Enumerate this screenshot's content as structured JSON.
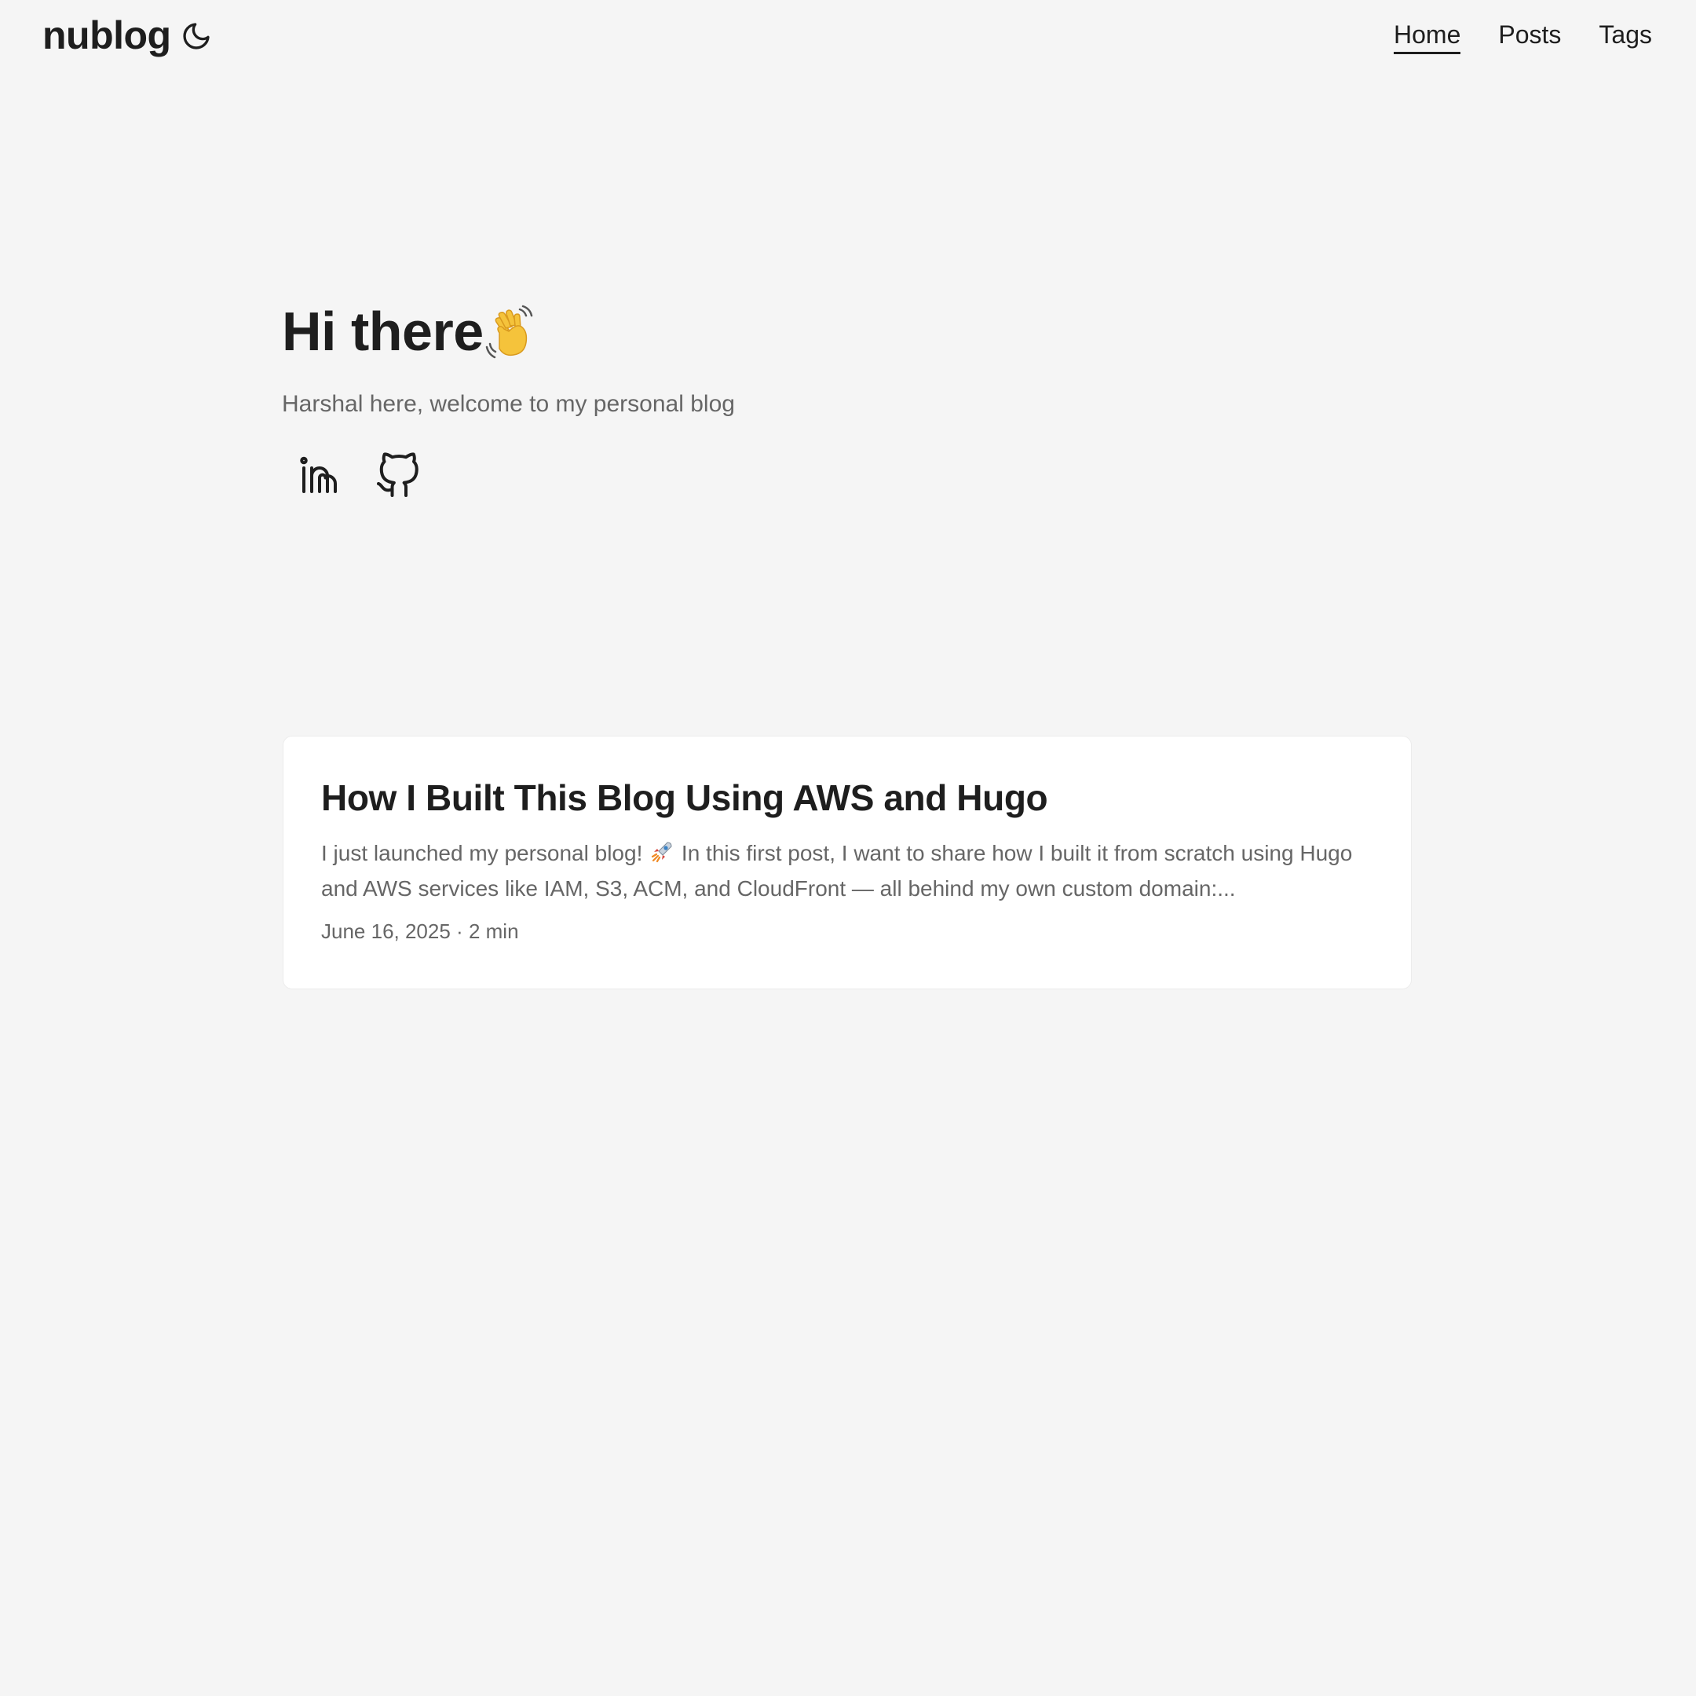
{
  "header": {
    "logo": "nublog",
    "theme_toggle_icon": "moon-icon",
    "nav": [
      {
        "label": "Home",
        "active": true
      },
      {
        "label": "Posts",
        "active": false
      },
      {
        "label": "Tags",
        "active": false
      }
    ]
  },
  "hero": {
    "title": "Hi there",
    "title_icon": "waving-hand-emoji",
    "subtitle": "Harshal here, welcome to my personal blog",
    "social": [
      {
        "icon": "linkedin-icon"
      },
      {
        "icon": "github-icon"
      }
    ]
  },
  "posts": [
    {
      "title": "How I Built This Blog Using AWS and Hugo",
      "excerpt_before_icon": "I just launched my personal blog!",
      "excerpt_icon": "rocket-emoji",
      "excerpt_after_icon": "In this first post, I want to share how I built it from scratch using Hugo and AWS services like IAM, S3, ACM, and CloudFront — all behind my own custom domain:...",
      "date": "June 16, 2025",
      "separator": "·",
      "reading_time": "2 min"
    }
  ],
  "colors": {
    "background": "#f5f5f5",
    "card": "#ffffff",
    "primary_text": "#1e1e1e",
    "secondary_text": "#666666",
    "card_border": "#ececec"
  }
}
